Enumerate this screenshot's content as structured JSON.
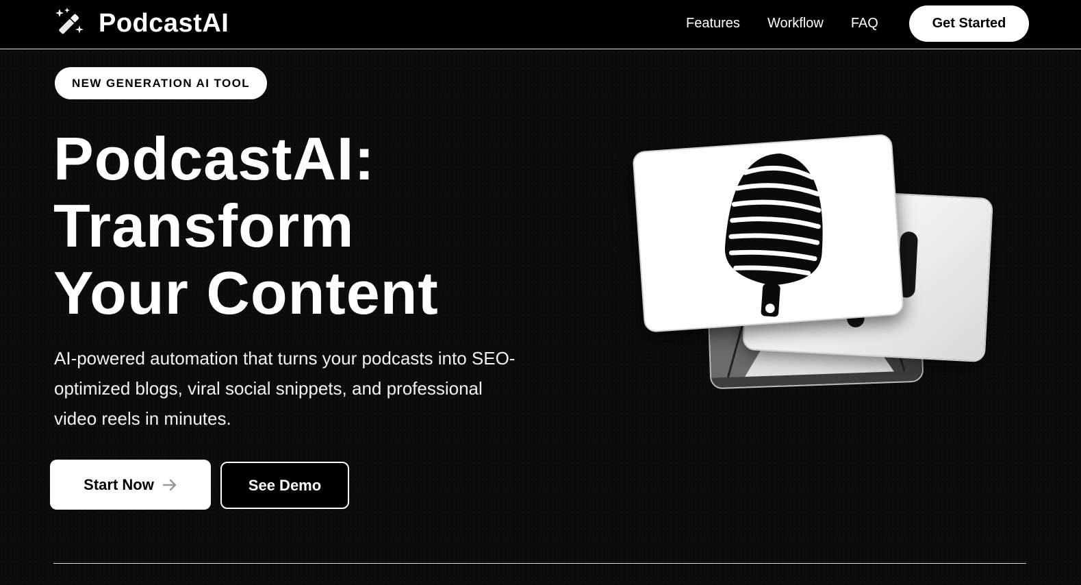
{
  "brand": {
    "name": "PodcastAI",
    "icon": "magic-wand-icon"
  },
  "nav": {
    "links": [
      "Features",
      "Workflow",
      "FAQ"
    ],
    "cta": "Get Started"
  },
  "hero": {
    "badge": "NEW GENERATION AI TOOL",
    "headline": [
      "PodcastAI:",
      "Transform",
      "Your Content"
    ],
    "subtext": "AI-powered automation that turns your podcasts into SEO-optimized blogs, viral social snippets, and professional video reels in minutes.",
    "primary_button": "Start Now",
    "primary_button_icon": "arrow-right-icon",
    "secondary_button": "See Demo",
    "image": "microphone-card-stack"
  }
}
